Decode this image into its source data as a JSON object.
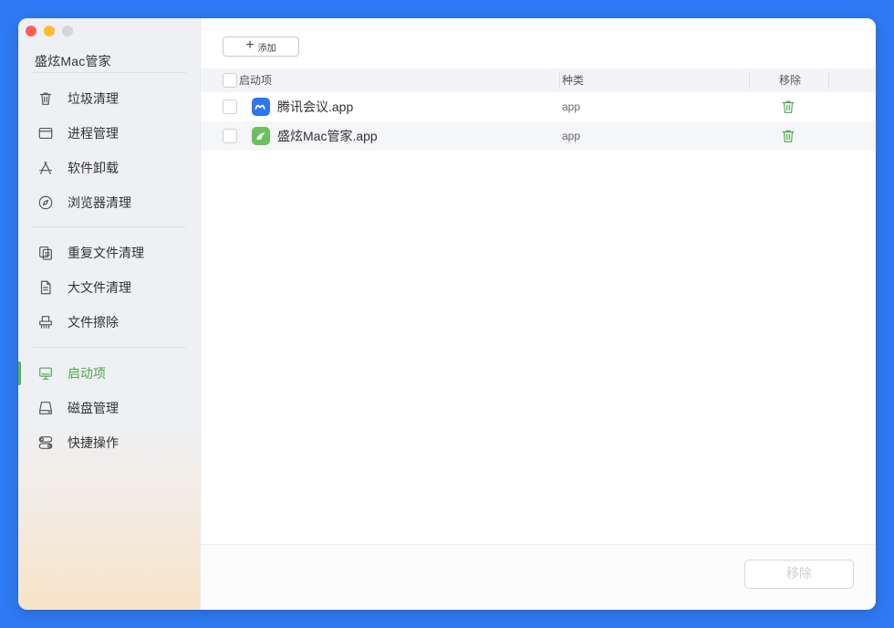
{
  "window": {
    "app_title": "盛炫Mac管家"
  },
  "sidebar": {
    "items": [
      {
        "label": "垃圾清理",
        "icon": "trash-icon"
      },
      {
        "label": "进程管理",
        "icon": "window-icon"
      },
      {
        "label": "软件卸载",
        "icon": "app-store-icon"
      },
      {
        "label": "浏览器清理",
        "icon": "compass-icon"
      },
      {
        "label": "重复文件清理",
        "icon": "duplicate-files-icon"
      },
      {
        "label": "大文件清理",
        "icon": "document-icon"
      },
      {
        "label": "文件擦除",
        "icon": "shredder-icon"
      },
      {
        "label": "启动项",
        "icon": "monitor-icon",
        "active": true
      },
      {
        "label": "磁盘管理",
        "icon": "disk-icon"
      },
      {
        "label": "快捷操作",
        "icon": "toggles-icon"
      }
    ]
  },
  "toolbar": {
    "add_label": "添加"
  },
  "table": {
    "headers": {
      "name": "启动项",
      "kind": "种类",
      "remove": "移除"
    },
    "rows": [
      {
        "name": "腾讯会议.app",
        "kind": "app",
        "icon": "tencent-meeting-icon"
      },
      {
        "name": "盛炫Mac管家.app",
        "kind": "app",
        "icon": "shengxuan-mac-icon"
      }
    ]
  },
  "footer": {
    "remove_label": "移除"
  },
  "colors": {
    "accent": "#4fa84a",
    "background": "#2f7bf5"
  }
}
